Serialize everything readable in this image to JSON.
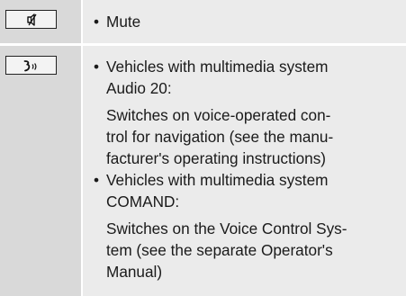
{
  "rows": [
    {
      "icon": "mute-icon",
      "items": [
        {
          "bullet": "Mute"
        }
      ]
    },
    {
      "icon": "voice-control-icon",
      "items": [
        {
          "bullet": "Vehicles with multimedia system Audio 20:",
          "bullet_lines": [
            "Vehicles with multimedia system",
            "Audio 20:"
          ],
          "desc_lines": [
            "Switches on voice-operated con-",
            "trol for navigation (see the manu-",
            "facturer's operating instructions)"
          ]
        },
        {
          "bullet": "Vehicles with multimedia system COMAND:",
          "bullet_lines": [
            "Vehicles with multimedia system",
            "COMAND:"
          ],
          "desc_lines": [
            "Switches on the Voice Control Sys-",
            "tem (see the separate Operator's",
            "Manual)"
          ]
        }
      ]
    }
  ],
  "bullet_glyph": "•"
}
